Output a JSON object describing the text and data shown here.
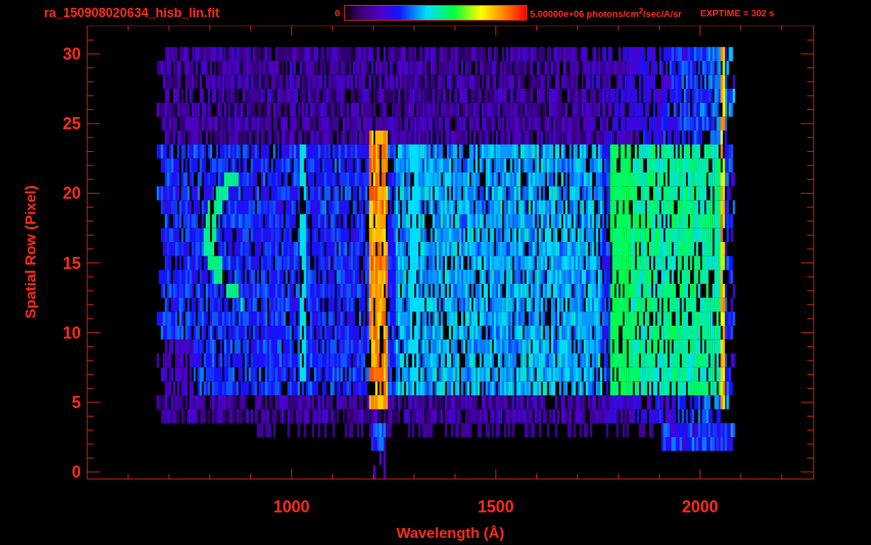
{
  "title": "ra_150908020634_hisb_lin.fit",
  "colorbar": {
    "min_label": "0",
    "max_label": "5.00000e+06 photons/cm$^{2}$/sec/A/sr"
  },
  "exposure": "EXPTIME = 302 s",
  "plot": {
    "xlabel": "Wavelength (Å)",
    "ylabel": "Spatial Row (Pixel)",
    "xticks": [
      "1000",
      "1500",
      "2000"
    ],
    "yticks": [
      "30",
      "25",
      "20",
      "15",
      "10",
      "5",
      "0"
    ]
  }
}
